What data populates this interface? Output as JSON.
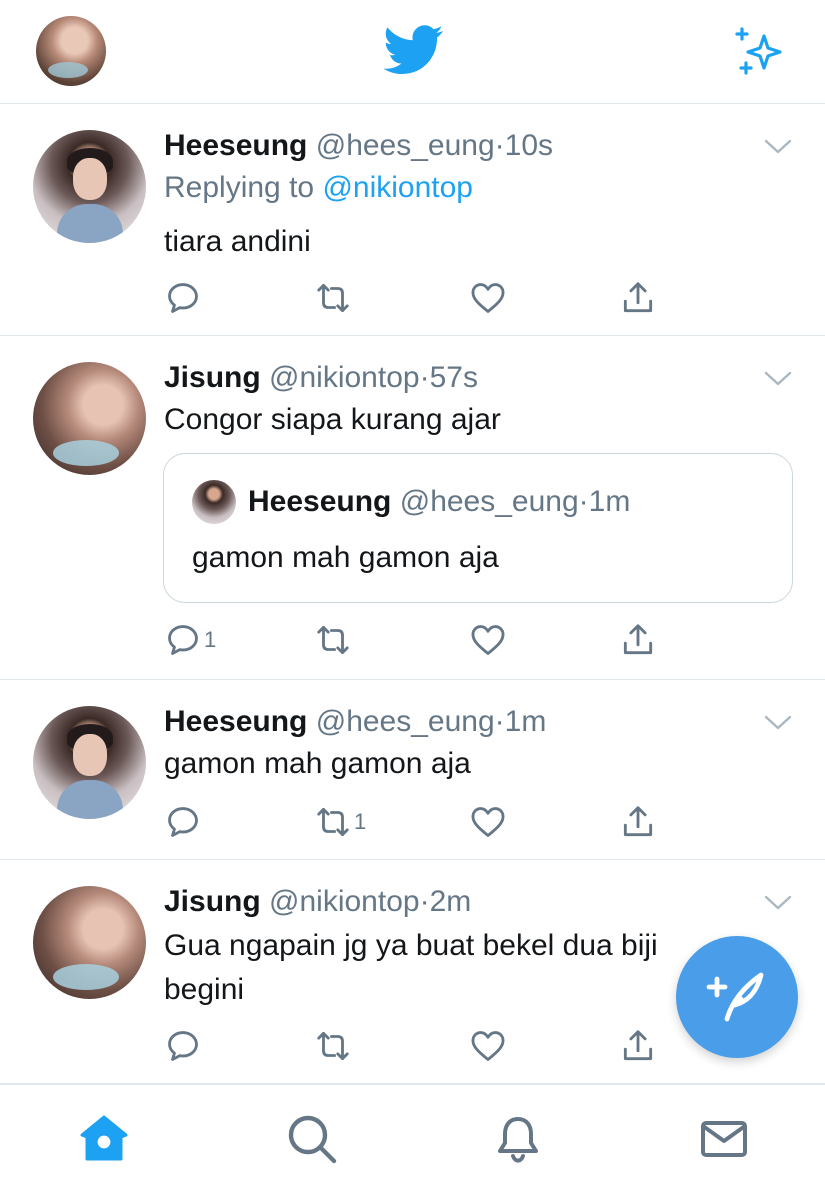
{
  "top": {
    "avatar": "profile-avatar",
    "logo": "twitter-bird-icon",
    "sparkle": "sparkle-icon"
  },
  "colors": {
    "accent": "#1da1f2",
    "muted": "#657786",
    "divider": "#e1e8ed",
    "fab": "#4a9de9"
  },
  "tweets": [
    {
      "name": "Heeseung",
      "handle": "@hees_eung",
      "dot": "·",
      "time": "10s",
      "reply_prefix": "Replying to ",
      "reply_mention": "@nikiontop",
      "text": "tiara andini",
      "counts": {
        "reply": "",
        "retweet": "",
        "like": ""
      }
    },
    {
      "name": "Jisung",
      "handle": "@nikiontop",
      "dot": "·",
      "time": "57s",
      "text": "Congor siapa kurang ajar",
      "quote": {
        "name": "Heeseung",
        "handle": "@hees_eung",
        "dot": "·",
        "time": "1m",
        "text": "gamon mah gamon aja"
      },
      "counts": {
        "reply": "1",
        "retweet": "",
        "like": ""
      }
    },
    {
      "name": "Heeseung",
      "handle": "@hees_eung",
      "dot": "·",
      "time": "1m",
      "text": "gamon mah gamon aja",
      "counts": {
        "reply": "",
        "retweet": "1",
        "like": ""
      }
    },
    {
      "name": "Jisung",
      "handle": "@nikiontop",
      "dot": "·",
      "time": "2m",
      "text": "Gua ngapain jg ya buat bekel dua biji begini",
      "counts": {
        "reply": "",
        "retweet": "",
        "like": ""
      }
    }
  ],
  "fab": {
    "icon": "compose-tweet-icon"
  },
  "tabs": [
    {
      "icon": "home-icon",
      "active": true
    },
    {
      "icon": "search-icon",
      "active": false
    },
    {
      "icon": "notifications-icon",
      "active": false
    },
    {
      "icon": "messages-icon",
      "active": false
    }
  ]
}
